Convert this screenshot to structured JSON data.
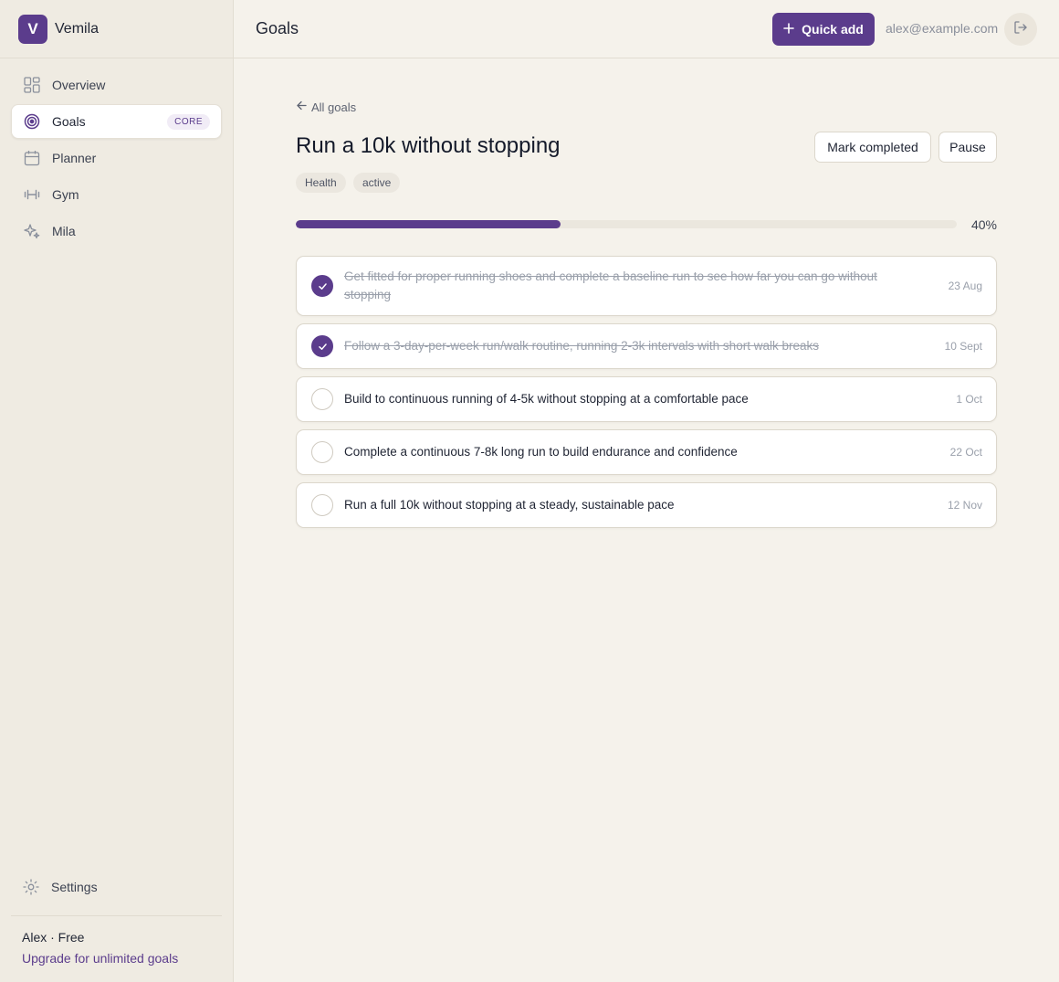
{
  "brand": {
    "logo_letter": "V",
    "name": "Vemila"
  },
  "nav": {
    "items": [
      {
        "label": "Overview",
        "icon": "grid-icon"
      },
      {
        "label": "Goals",
        "icon": "target-icon",
        "badge": "CORE"
      },
      {
        "label": "Planner",
        "icon": "calendar-icon"
      },
      {
        "label": "Gym",
        "icon": "dumbbell-icon"
      },
      {
        "label": "Mila",
        "icon": "sparkle-icon"
      }
    ],
    "settings_label": "Settings"
  },
  "account": {
    "plan_text": "Alex · Free",
    "upgrade_link": "Upgrade for unlimited goals"
  },
  "topbar": {
    "title": "Goals",
    "quick_add_label": "Quick add",
    "email": "alex@example.com"
  },
  "goal": {
    "back_label": "All goals",
    "title": "Run a 10k without stopping",
    "actions": {
      "mark_completed": "Mark completed",
      "pause": "Pause"
    },
    "category": "Health",
    "status": "active",
    "progress_fraction": 0.4,
    "progress_label": "40%",
    "milestones": [
      {
        "text": "Get fitted for proper running shoes and complete a baseline run to see how far you can go without stopping",
        "date": "23 Aug",
        "done": true
      },
      {
        "text": "Follow a 3-day-per-week run/walk routine, running 2-3k intervals with short walk breaks",
        "date": "10 Sept",
        "done": true
      },
      {
        "text": "Build to continuous running of 4-5k without stopping at a comfortable pace",
        "date": "1 Oct",
        "done": false
      },
      {
        "text": "Complete a continuous 7-8k long run to build endurance and confidence",
        "date": "22 Oct",
        "done": false
      },
      {
        "text": "Run a full 10k without stopping at a steady, sustainable pace",
        "date": "12 Nov",
        "done": false
      }
    ]
  },
  "colors": {
    "accent": "#5b3c8c",
    "background": "#f5f2eb",
    "sidebar": "#efebe2"
  }
}
